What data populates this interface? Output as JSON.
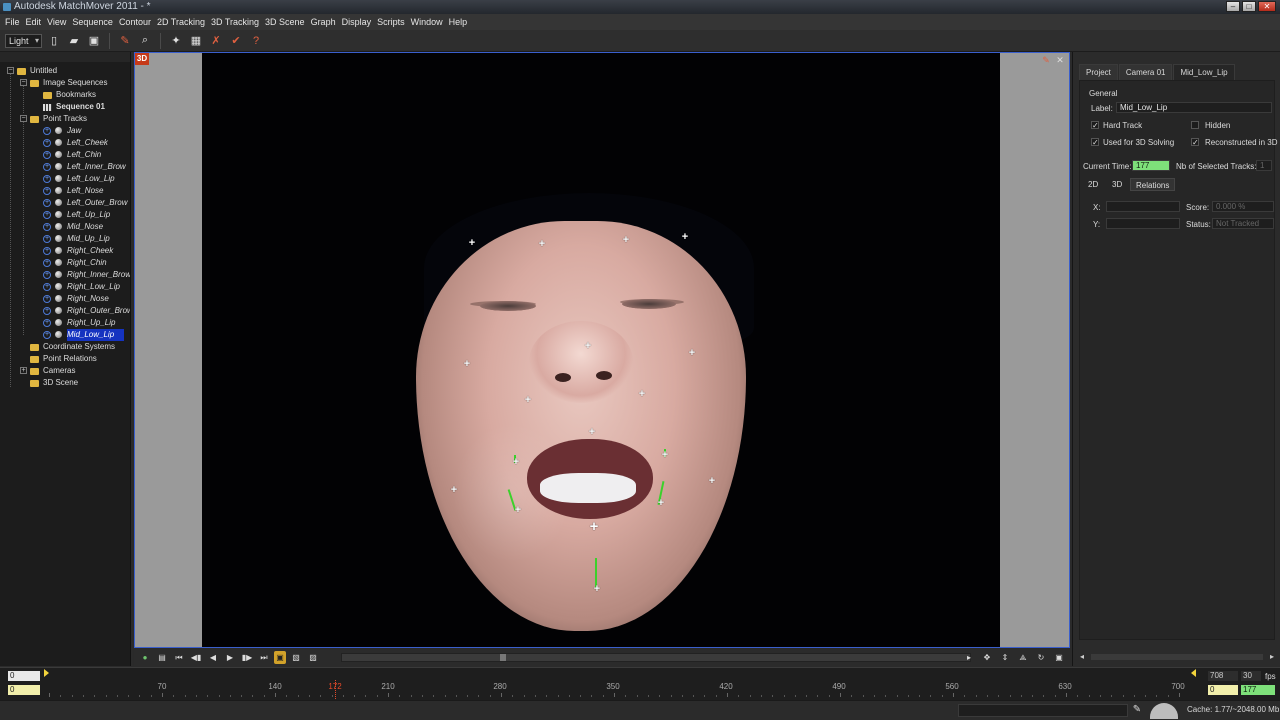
{
  "window": {
    "title": "Autodesk MatchMover 2011 - *"
  },
  "menu": [
    "File",
    "Edit",
    "View",
    "Sequence",
    "Contour",
    "2D Tracking",
    "3D Tracking",
    "3D Scene",
    "Graph",
    "Display",
    "Scripts",
    "Window",
    "Help"
  ],
  "toolbar": {
    "mode": "Light"
  },
  "tree": {
    "root": "Untitled",
    "image_sequences": "Image Sequences",
    "bookmarks": "Bookmarks",
    "sequence": "Sequence 01",
    "point_tracks": "Point Tracks",
    "tracks": [
      "Jaw",
      "Left_Cheek",
      "Left_Chin",
      "Left_Inner_Brow",
      "Left_Low_Lip",
      "Left_Nose",
      "Left_Outer_Brow",
      "Left_Up_Lip",
      "Mid_Nose",
      "Mid_Up_Lip",
      "Right_Cheek",
      "Right_Chin",
      "Right_Inner_Brow",
      "Right_Low_Lip",
      "Right_Nose",
      "Right_Outer_Brow",
      "Right_Up_Lip",
      "Mid_Low_Lip"
    ],
    "coordinate_systems": "Coordinate Systems",
    "point_relations": "Point Relations",
    "cameras": "Cameras",
    "scene_3d": "3D Scene"
  },
  "viewport": {
    "badge": "3D"
  },
  "props": {
    "tabs": [
      "Project",
      "Camera 01",
      "Mid_Low_Lip"
    ],
    "section": "General",
    "label_caption": "Label:",
    "label_value": "Mid_Low_Lip",
    "hard_track": "Hard Track",
    "hidden": "Hidden",
    "used_for_3d": "Used for 3D Solving",
    "reconstructed_3d": "Reconstructed in 3D",
    "current_time_caption": "Current Time:",
    "current_time": "177",
    "selected_tracks_caption": "Nb of Selected Tracks:",
    "selected_tracks": "1",
    "subtabs": [
      "2D",
      "3D",
      "Relations"
    ],
    "x_caption": "X:",
    "y_caption": "Y:",
    "score_caption": "Score:",
    "score_value": "0.000 %",
    "status_caption": "Status:",
    "status_value": "Not Tracked"
  },
  "timeline": {
    "start_top": "0",
    "start_bottom": "0",
    "end_top": "708",
    "fps": "30",
    "fps_label": "fps",
    "end_bottom": "0",
    "current": "177",
    "playhead_label": "172",
    "ticks": [
      "70",
      "140",
      "210",
      "280",
      "350",
      "420",
      "490",
      "560",
      "630",
      "700"
    ]
  },
  "status": {
    "cache": "Cache: 1.77/~2048.00 Mb"
  }
}
